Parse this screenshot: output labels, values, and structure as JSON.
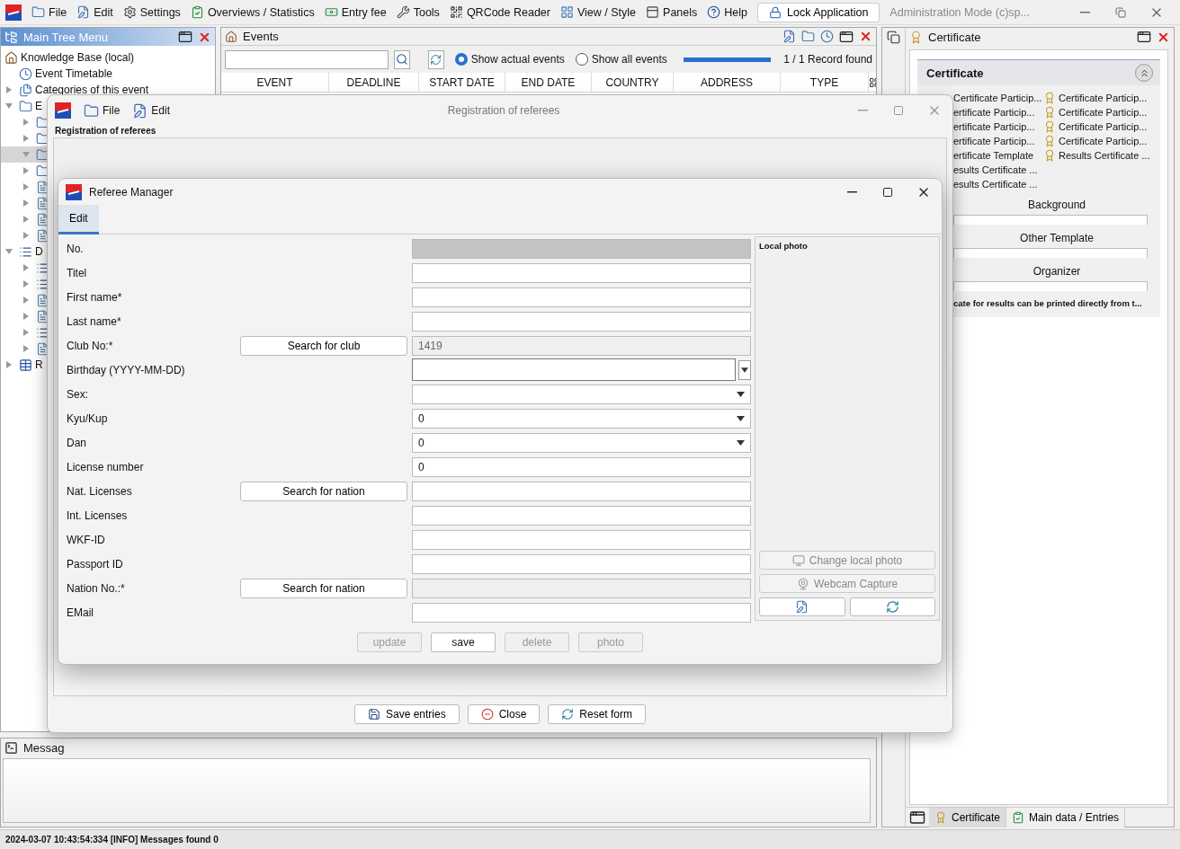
{
  "menu_bar": {
    "items": [
      {
        "label": "File"
      },
      {
        "label": "Edit"
      },
      {
        "label": "Settings"
      },
      {
        "label": "Overviews / Statistics"
      },
      {
        "label": "Entry fee"
      },
      {
        "label": "Tools"
      },
      {
        "label": "QRCode Reader"
      },
      {
        "label": "View / Style"
      },
      {
        "label": "Panels"
      },
      {
        "label": "Help"
      }
    ],
    "lock_button": "Lock Application",
    "mode_text": "Administration Mode (c)sp..."
  },
  "tree_panel": {
    "title": "Main Tree Menu",
    "root": {
      "label": "Knowledge Base (local)",
      "selected": false,
      "children": [
        {
          "label": "Event Timetable",
          "selected": false
        },
        {
          "label": "Categories of this event",
          "expanded": false,
          "selected": false
        },
        {
          "label": "E",
          "expanded": true,
          "selected": false,
          "children": [
            {
              "expanded": false,
              "selected": false
            },
            {
              "expanded": false,
              "selected": false
            },
            {
              "expanded": true,
              "selected": true
            },
            {
              "expanded": false,
              "selected": false
            },
            {
              "expanded": false,
              "selected": false
            },
            {
              "expanded": false,
              "selected": false
            },
            {
              "expanded": false,
              "selected": false
            },
            {
              "expanded": false,
              "selected": false
            }
          ]
        },
        {
          "label": "D",
          "expanded": true,
          "selected": false,
          "children": [
            {
              "expanded": false,
              "selected": false
            },
            {
              "expanded": false,
              "selected": false
            },
            {
              "expanded": false,
              "selected": false
            },
            {
              "expanded": false,
              "selected": false
            },
            {
              "expanded": false,
              "selected": false
            },
            {
              "expanded": false,
              "selected": false
            }
          ]
        },
        {
          "label": "R",
          "expanded": false,
          "selected": false
        }
      ]
    }
  },
  "events_panel": {
    "title": "Events",
    "filters": [
      {
        "label": "Show actual events",
        "selected": true
      },
      {
        "label": "Show all events",
        "selected": false
      }
    ],
    "progress": {
      "level": 1
    },
    "record_count": "1 / 1 Record found",
    "columns": [
      "EVENT",
      "DEADLINE",
      "START DATE",
      "END DATE",
      "COUNTRY",
      "ADDRESS",
      "TYPE"
    ]
  },
  "messages_panel": {
    "title": "Messag"
  },
  "certificate_panel": {
    "title": "Certificate",
    "section": {
      "title": "Certificate",
      "expanded": true,
      "left_column": [
        "Certificate Particip...",
        "ertificate Particip...",
        "ertificate Particip...",
        "ertificate Particip...",
        "ertificate Template",
        "esults Certificate ...",
        "esults Certificate ..."
      ],
      "right_column": [
        "Certificate Particip...",
        "Certificate Particip...",
        "Certificate Particip...",
        "Certificate Particip...",
        "Results Certificate ..."
      ],
      "fields": [
        "Background",
        "Other Template",
        "Organizer"
      ],
      "note": "cate for results can be printed directly from t..."
    },
    "tabs": [
      {
        "label": "Certificate",
        "selected": true
      },
      {
        "label": "Main data / Entries",
        "selected": false
      }
    ]
  },
  "status_bar": "2024-03-07 10:43:54:334 [INFO] Messages found 0",
  "registration_window": {
    "title": "Registration of referees",
    "menu": [
      {
        "label": "File"
      },
      {
        "label": "Edit"
      }
    ],
    "group_title": "Registration of referees",
    "buttons": [
      {
        "label": "Save entries"
      },
      {
        "label": "Close"
      },
      {
        "label": "Reset form"
      }
    ]
  },
  "referee_manager": {
    "title": "Referee Manager",
    "tabs": [
      {
        "label": "Edit",
        "selected": true
      }
    ],
    "fields": [
      {
        "label": "No.",
        "kind": "readonly"
      },
      {
        "label": "Titel",
        "kind": "text"
      },
      {
        "label": "First name*",
        "kind": "text"
      },
      {
        "label": "Last name*",
        "kind": "text"
      },
      {
        "label": "Club No:*",
        "kind": "disabled",
        "button": "Search for club",
        "value": "1419"
      },
      {
        "label": "Birthday (YYYY-MM-DD)",
        "kind": "date"
      },
      {
        "label": "Sex:",
        "kind": "select"
      },
      {
        "label": "Kyu/Kup",
        "kind": "select",
        "value": "0"
      },
      {
        "label": "Dan",
        "kind": "select",
        "value": "0"
      },
      {
        "label": "License number",
        "kind": "text",
        "value": "0"
      },
      {
        "label": "Nat. Licenses",
        "kind": "text",
        "button": "Search for nation"
      },
      {
        "label": "Int. Licenses",
        "kind": "text"
      },
      {
        "label": "WKF-ID",
        "kind": "text"
      },
      {
        "label": "Passport ID",
        "kind": "text"
      },
      {
        "label": "Nation No.:*",
        "kind": "disabled",
        "button": "Search for nation"
      },
      {
        "label": "EMail",
        "kind": "text"
      }
    ],
    "photo": {
      "title": "Local photo",
      "buttons": [
        {
          "label": "Change local photo",
          "disabled": true
        },
        {
          "label": "Webcam Capture",
          "disabled": true
        }
      ]
    },
    "buttons": [
      {
        "label": "update",
        "disabled": true
      },
      {
        "label": "save",
        "disabled": false
      },
      {
        "label": "delete",
        "disabled": true
      },
      {
        "label": "photo",
        "disabled": true
      }
    ]
  }
}
